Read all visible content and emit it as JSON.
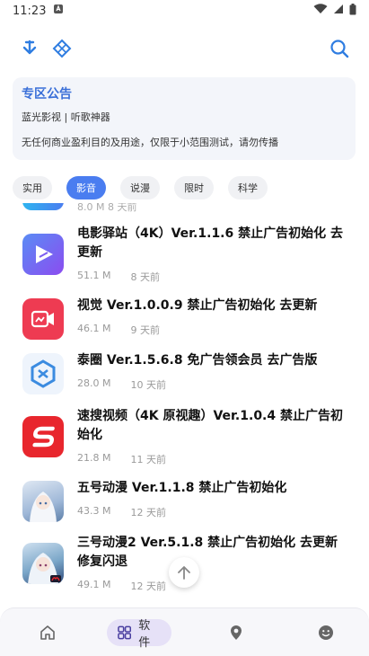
{
  "status": {
    "time": "11:23"
  },
  "notice": {
    "title": "专区公告",
    "line1": "蓝光影视 | 听歌神器",
    "line2": "无任何商业盈利目的及用途，仅限于小范围测试，请勿传播"
  },
  "tabs": [
    {
      "label": "实用",
      "active": false
    },
    {
      "label": "影音",
      "active": true
    },
    {
      "label": "说漫",
      "active": false
    },
    {
      "label": "限时",
      "active": false
    },
    {
      "label": "科学",
      "active": false
    }
  ],
  "list": {
    "partial_meta": "8.0 M    8 天前",
    "items": [
      {
        "title": "电影驿站（4K）Ver.1.1.6 禁止广告初始化 去更新",
        "size": "51.1 M",
        "time": "8 天前",
        "icon": "play-triangle-icon",
        "color": "#7b5cf0"
      },
      {
        "title": "视觉 Ver.1.0.0.9 禁止广告初始化 去更新",
        "size": "46.1 M",
        "time": "9 天前",
        "icon": "video-camera-icon",
        "color": "#ee3b52"
      },
      {
        "title": "泰圈 Ver.1.5.6.8 免广告领会员 去广告版",
        "size": "28.0 M",
        "time": "10 天前",
        "icon": "hexagon-logo-icon",
        "color": "#3b8be0"
      },
      {
        "title": "速搜视频（4K 原视趣）Ver.1.0.4 禁止广告初始化",
        "size": "21.8 M",
        "time": "11 天前",
        "icon": "s-logo-icon",
        "color": "#e8262d"
      },
      {
        "title": "五号动漫 Ver.1.1.8 禁止广告初始化",
        "size": "43.3 M",
        "time": "12 天前",
        "icon": "anime-girl-icon",
        "color": "#9fb8d8"
      },
      {
        "title": "三号动漫2 Ver.5.1.8 禁止广告初始化 去更新修复闪退",
        "size": "49.1 M",
        "time": "12 天前",
        "icon": "anime-girl-icon",
        "color": "#7aa6c8"
      }
    ]
  },
  "nav": {
    "software_label": "软件"
  }
}
